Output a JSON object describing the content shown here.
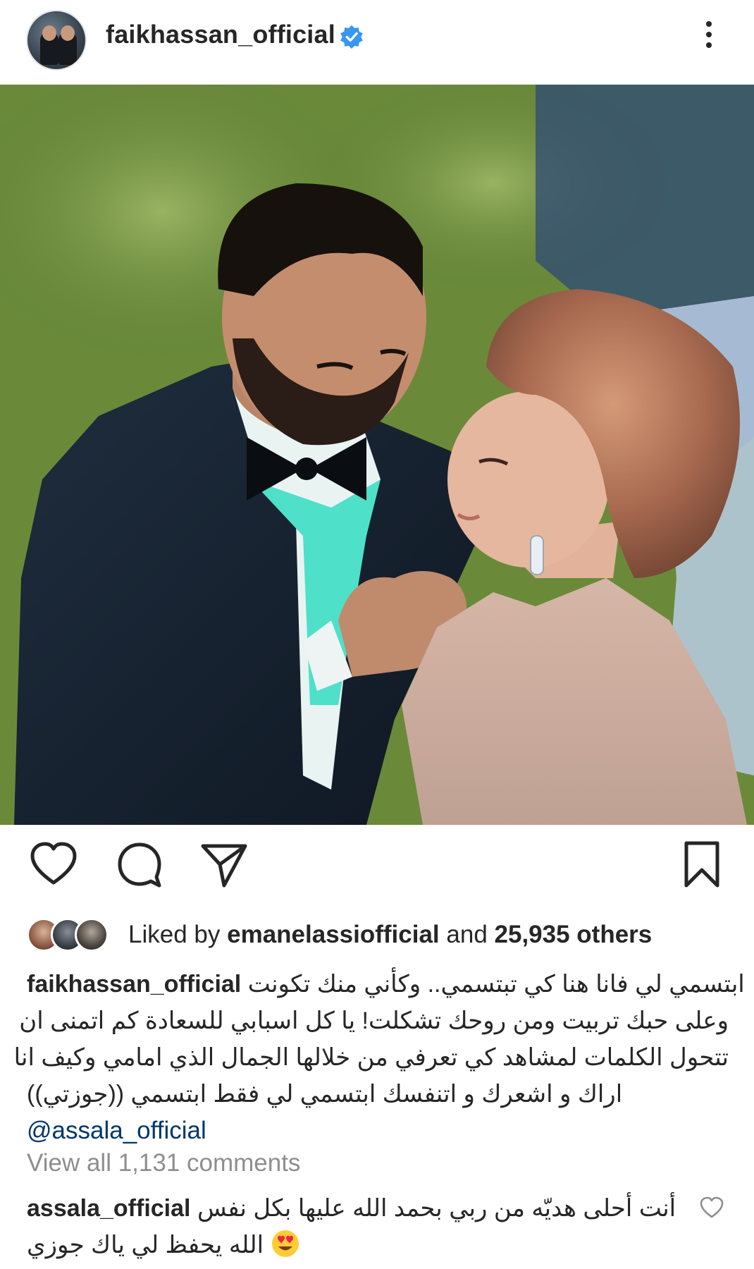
{
  "post": {
    "username": "faikhassan_official",
    "verified": true,
    "avatar_icon": "profile-avatar",
    "more_icon": "more-vertical-icon"
  },
  "photo": {
    "subject": "couple-portrait"
  },
  "actions": {
    "like_icon": "heart-icon",
    "comment_icon": "comment-icon",
    "share_icon": "share-icon",
    "save_icon": "bookmark-icon"
  },
  "likes": {
    "prefix": "Liked by",
    "user": "emanelassiofficial",
    "joiner": "and",
    "others": "25,935 others"
  },
  "caption": {
    "username": "faikhassan_official",
    "line1": "ابتسمي لي فانا هنا كي تبتسمي.. وكأني منك تكونت",
    "line2": "وعلى حبك تربيت ومن روحك تشكلت! يا كل اسبابي للسعادة كم اتمنى ان",
    "line3": "تتحول الكلمات لمشاهد كي تعرفي من خلالها الجمال الذي امامي وكيف انا",
    "line4": "اراك و اشعرك و اتنفسك ابتسمي لي فقط ابتسمي ((جوزتي))",
    "mention": "@assala_official"
  },
  "view_all_comments": "View all 1,131 comments",
  "comment": {
    "username": "assala_official",
    "line1": "أنت أحلى هديّه من ربي بحمد الله عليها بكل نفس",
    "line2": "الله يحفظ لي ياك جوزي",
    "emoji": "heart-eyes-emoji"
  },
  "colors": {
    "text": "#262626",
    "muted": "#8e8e8e",
    "link": "#00376b",
    "verified": "#3897f0"
  }
}
